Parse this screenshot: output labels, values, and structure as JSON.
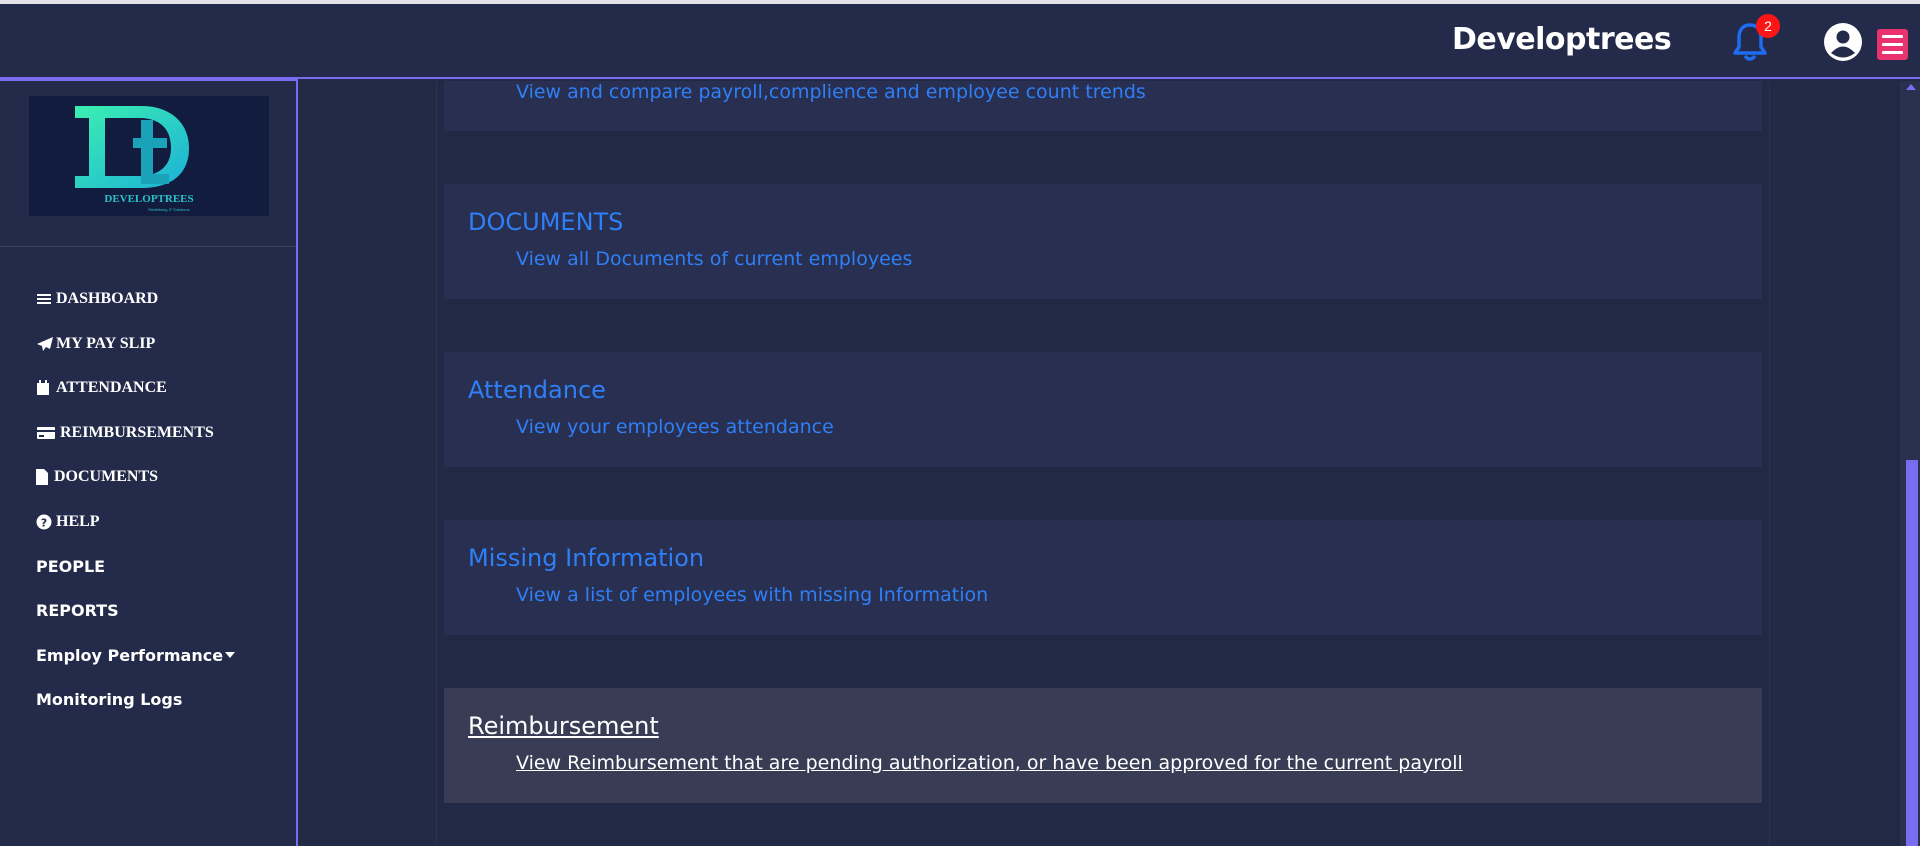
{
  "header": {
    "brand": "Developtrees",
    "notification_count": "2"
  },
  "logo": {
    "text": "DEVELOPTREES",
    "tagline": "Redefining IT Solutions"
  },
  "sidebar": {
    "items": [
      {
        "label": "DASHBOARD",
        "icon": "bars-icon"
      },
      {
        "label": "MY PAY SLIP",
        "icon": "paper-plane-icon"
      },
      {
        "label": "ATTENDANCE",
        "icon": "calendar-icon"
      },
      {
        "label": "REIMBURSEMENTS",
        "icon": "credit-card-icon"
      },
      {
        "label": "DOCUMENTS",
        "icon": "file-icon"
      },
      {
        "label": "HELP",
        "icon": "question-circle-icon"
      },
      {
        "label": "PEOPLE"
      },
      {
        "label": "REPORTS"
      },
      {
        "label": "Employ Performance",
        "icon": "caret-down-icon"
      },
      {
        "label": "Monitoring Logs"
      }
    ]
  },
  "cards": [
    {
      "title": "",
      "desc": "View and compare payroll,complience and employee count trends"
    },
    {
      "title": "DOCUMENTS",
      "desc": "View all Documents of current employees"
    },
    {
      "title": "Attendance",
      "desc": "View your employees attendance"
    },
    {
      "title": "Missing Information",
      "desc": "View a list of employees with missing Information"
    },
    {
      "title": "Reimbursement",
      "desc": "View Reimbursement that are pending authorization, or have been approved for the current payroll"
    }
  ],
  "colors": {
    "accent": "#7a6cf0",
    "link": "#2f7ff7",
    "badge": "#ff1515",
    "menu_button": "#e8336f"
  }
}
